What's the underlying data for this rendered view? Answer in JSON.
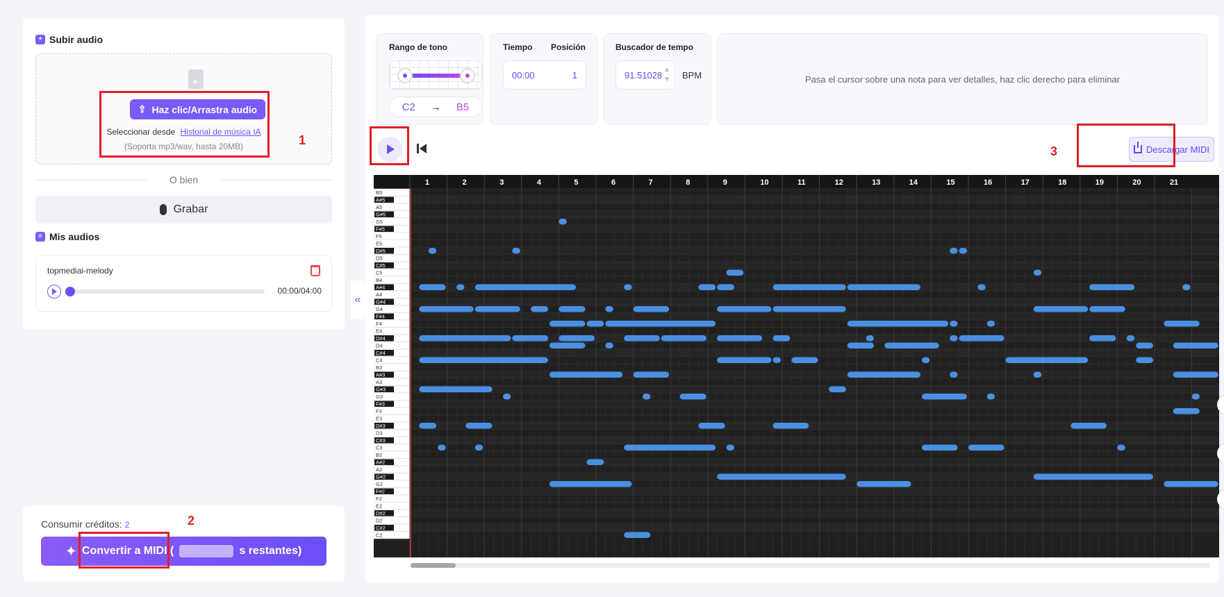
{
  "upload": {
    "title": "Subir audio",
    "button": "Haz clic/Arrastra audio",
    "select_from": "Seleccionar desde",
    "history_link": "Historial de música IA",
    "support": "(Soporta mp3/wav, hasta 20MB)"
  },
  "or_label": "O bien",
  "record_label": "Grabar",
  "my_audios": {
    "title": "Mis audios",
    "item": {
      "name": "topmediai-melody",
      "time": "00:00/04:00",
      "progress": 0
    }
  },
  "credits": {
    "label": "Consumir créditos:",
    "value": "2"
  },
  "convert": {
    "label": "Convertir a MIDI (",
    "suffix": "s restantes)"
  },
  "pitch_range": {
    "title": "Rango de tono",
    "low": "C2",
    "arrow": "→",
    "high": "B5"
  },
  "time_card": {
    "time_label": "Tiempo",
    "position_label": "Posición",
    "time": "00:00",
    "position": "1"
  },
  "tempo": {
    "title": "Buscador de tempo",
    "value": "91.51028",
    "unit": "BPM"
  },
  "hint": "Pasa el cursor sobre una nota para ver detalles, haz clic derecho para eliminar",
  "download_label": "Descargar MIDI",
  "annotations": [
    "1",
    "2",
    "3"
  ],
  "piano_roll": {
    "measures": [
      "1",
      "2",
      "3",
      "4",
      "5",
      "6",
      "7",
      "8",
      "9",
      "10",
      "11",
      "12",
      "13",
      "14",
      "15",
      "16",
      "17",
      "18",
      "19",
      "20",
      "21"
    ],
    "keys": [
      "B5",
      "A#5",
      "A5",
      "G#5",
      "G5",
      "F#5",
      "F5",
      "E5",
      "D#5",
      "D5",
      "C#5",
      "C5",
      "B4",
      "A#4",
      "A4",
      "G#4",
      "G4",
      "F#4",
      "F4",
      "E4",
      "D#4",
      "D4",
      "C#4",
      "C4",
      "B3",
      "A#3",
      "A3",
      "G#3",
      "G3",
      "F#3",
      "F3",
      "E3",
      "D#3",
      "D3",
      "C#3",
      "C3",
      "B2",
      "A#2",
      "A2",
      "G#2",
      "G2",
      "F#2",
      "F2",
      "E2",
      "D#2",
      "D2",
      "C#2",
      "C2"
    ],
    "notes": [
      {
        "pitch": "G5",
        "start": 4.0,
        "len": 0.25
      },
      {
        "pitch": "D#5",
        "start": 0.5,
        "len": 0.25
      },
      {
        "pitch": "D#5",
        "start": 2.75,
        "len": 0.25
      },
      {
        "pitch": "D#5",
        "start": 14.5,
        "len": 0.25
      },
      {
        "pitch": "D#5",
        "start": 14.75,
        "len": 0.25
      },
      {
        "pitch": "C5",
        "start": 8.5,
        "len": 0.5
      },
      {
        "pitch": "C5",
        "start": 16.75,
        "len": 0.25
      },
      {
        "pitch": "A#4",
        "start": 0.25,
        "len": 0.75
      },
      {
        "pitch": "A#4",
        "start": 1.25,
        "len": 0.25
      },
      {
        "pitch": "A#4",
        "start": 1.75,
        "len": 2.75
      },
      {
        "pitch": "A#4",
        "start": 5.75,
        "len": 0.25
      },
      {
        "pitch": "A#4",
        "start": 7.75,
        "len": 0.5
      },
      {
        "pitch": "A#4",
        "start": 8.25,
        "len": 0.5
      },
      {
        "pitch": "A#4",
        "start": 9.75,
        "len": 2.0
      },
      {
        "pitch": "A#4",
        "start": 11.75,
        "len": 2.0
      },
      {
        "pitch": "A#4",
        "start": 15.25,
        "len": 0.25
      },
      {
        "pitch": "A#4",
        "start": 18.25,
        "len": 1.25
      },
      {
        "pitch": "A#4",
        "start": 20.75,
        "len": 0.25
      },
      {
        "pitch": "G4",
        "start": 0.25,
        "len": 1.5
      },
      {
        "pitch": "G4",
        "start": 1.75,
        "len": 1.25
      },
      {
        "pitch": "G4",
        "start": 3.25,
        "len": 0.5
      },
      {
        "pitch": "G4",
        "start": 4.0,
        "len": 0.75
      },
      {
        "pitch": "G4",
        "start": 5.25,
        "len": 0.25
      },
      {
        "pitch": "G4",
        "start": 6.0,
        "len": 1.0
      },
      {
        "pitch": "G4",
        "start": 8.25,
        "len": 1.5
      },
      {
        "pitch": "G4",
        "start": 9.75,
        "len": 2.0
      },
      {
        "pitch": "G4",
        "start": 16.75,
        "len": 1.5
      },
      {
        "pitch": "G4",
        "start": 18.25,
        "len": 1.0
      },
      {
        "pitch": "F4",
        "start": 3.75,
        "len": 1.0
      },
      {
        "pitch": "F4",
        "start": 4.75,
        "len": 0.5
      },
      {
        "pitch": "F4",
        "start": 5.25,
        "len": 3.0
      },
      {
        "pitch": "F4",
        "start": 11.75,
        "len": 2.75
      },
      {
        "pitch": "F4",
        "start": 14.5,
        "len": 0.25
      },
      {
        "pitch": "F4",
        "start": 15.5,
        "len": 0.25
      },
      {
        "pitch": "F4",
        "start": 20.25,
        "len": 1.0
      },
      {
        "pitch": "D#4",
        "start": 0.25,
        "len": 2.5
      },
      {
        "pitch": "D#4",
        "start": 2.75,
        "len": 1.0
      },
      {
        "pitch": "D#4",
        "start": 4.0,
        "len": 1.0
      },
      {
        "pitch": "D#4",
        "start": 5.75,
        "len": 1.0
      },
      {
        "pitch": "D#4",
        "start": 6.75,
        "len": 1.25
      },
      {
        "pitch": "D#4",
        "start": 8.25,
        "len": 1.25
      },
      {
        "pitch": "D#4",
        "start": 9.75,
        "len": 0.5
      },
      {
        "pitch": "D#4",
        "start": 12.25,
        "len": 0.25
      },
      {
        "pitch": "D#4",
        "start": 14.5,
        "len": 0.25
      },
      {
        "pitch": "D#4",
        "start": 14.75,
        "len": 1.25
      },
      {
        "pitch": "D#4",
        "start": 18.25,
        "len": 0.75
      },
      {
        "pitch": "D#4",
        "start": 19.25,
        "len": 0.25
      },
      {
        "pitch": "D4",
        "start": 3.75,
        "len": 1.0
      },
      {
        "pitch": "D4",
        "start": 5.25,
        "len": 0.25
      },
      {
        "pitch": "D4",
        "start": 11.75,
        "len": 0.75
      },
      {
        "pitch": "D4",
        "start": 12.75,
        "len": 1.5
      },
      {
        "pitch": "D4",
        "start": 19.5,
        "len": 0.5
      },
      {
        "pitch": "D4",
        "start": 20.5,
        "len": 1.25
      },
      {
        "pitch": "C4",
        "start": 0.25,
        "len": 3.5
      },
      {
        "pitch": "C4",
        "start": 8.25,
        "len": 1.5
      },
      {
        "pitch": "C4",
        "start": 9.75,
        "len": 0.25
      },
      {
        "pitch": "C4",
        "start": 10.25,
        "len": 0.75
      },
      {
        "pitch": "C4",
        "start": 13.75,
        "len": 0.25
      },
      {
        "pitch": "C4",
        "start": 16.0,
        "len": 2.25
      },
      {
        "pitch": "C4",
        "start": 19.5,
        "len": 0.5
      },
      {
        "pitch": "A#3",
        "start": 3.75,
        "len": 2.0
      },
      {
        "pitch": "A#3",
        "start": 6.0,
        "len": 1.0
      },
      {
        "pitch": "A#3",
        "start": 11.75,
        "len": 2.0
      },
      {
        "pitch": "A#3",
        "start": 14.5,
        "len": 0.25
      },
      {
        "pitch": "A#3",
        "start": 16.75,
        "len": 0.25
      },
      {
        "pitch": "A#3",
        "start": 20.5,
        "len": 1.25
      },
      {
        "pitch": "G#3",
        "start": 0.25,
        "len": 2.0
      },
      {
        "pitch": "G#3",
        "start": 11.25,
        "len": 0.5
      },
      {
        "pitch": "G3",
        "start": 2.5,
        "len": 0.25
      },
      {
        "pitch": "G3",
        "start": 6.25,
        "len": 0.25
      },
      {
        "pitch": "G3",
        "start": 7.25,
        "len": 0.75
      },
      {
        "pitch": "G3",
        "start": 13.75,
        "len": 1.25
      },
      {
        "pitch": "G3",
        "start": 15.5,
        "len": 0.25
      },
      {
        "pitch": "G3",
        "start": 21.0,
        "len": 0.25
      },
      {
        "pitch": "F3",
        "start": 20.5,
        "len": 0.75
      },
      {
        "pitch": "D#3",
        "start": 0.25,
        "len": 0.5
      },
      {
        "pitch": "D#3",
        "start": 1.5,
        "len": 0.75
      },
      {
        "pitch": "D#3",
        "start": 7.75,
        "len": 0.75
      },
      {
        "pitch": "D#3",
        "start": 9.75,
        "len": 1.0
      },
      {
        "pitch": "D#3",
        "start": 17.75,
        "len": 1.0
      },
      {
        "pitch": "C3",
        "start": 0.75,
        "len": 0.25
      },
      {
        "pitch": "C3",
        "start": 1.75,
        "len": 0.25
      },
      {
        "pitch": "C3",
        "start": 5.75,
        "len": 2.5
      },
      {
        "pitch": "C3",
        "start": 8.5,
        "len": 0.25
      },
      {
        "pitch": "C3",
        "start": 13.75,
        "len": 1.0
      },
      {
        "pitch": "C3",
        "start": 15.0,
        "len": 1.0
      },
      {
        "pitch": "C3",
        "start": 19.0,
        "len": 0.25
      },
      {
        "pitch": "A#2",
        "start": 4.75,
        "len": 0.5
      },
      {
        "pitch": "G#2",
        "start": 8.25,
        "len": 3.5
      },
      {
        "pitch": "G#2",
        "start": 16.75,
        "len": 3.25
      },
      {
        "pitch": "G2",
        "start": 3.75,
        "len": 2.25
      },
      {
        "pitch": "G2",
        "start": 12.0,
        "len": 1.5
      },
      {
        "pitch": "G2",
        "start": 20.25,
        "len": 1.5
      },
      {
        "pitch": "C2",
        "start": 5.75,
        "len": 0.75
      }
    ]
  },
  "colors": {
    "accent": "#7a5af8",
    "note": "#4a90e2",
    "annotation": "#e01e25",
    "playhead": "#e0393e"
  }
}
